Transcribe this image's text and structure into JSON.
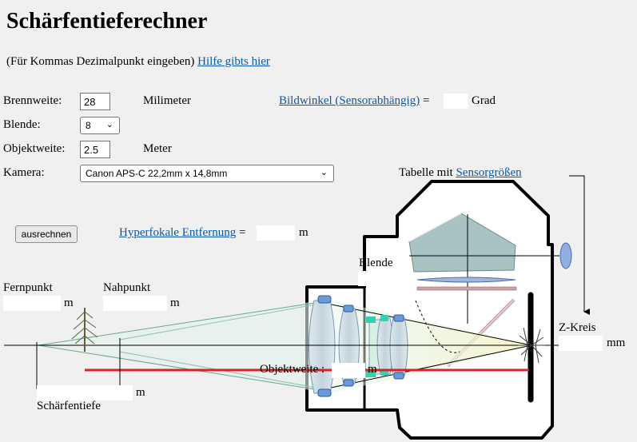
{
  "title": "Schärfentieferechner",
  "intro": {
    "text": "(Für Kommas Dezimalpunkt eingeben)",
    "help_link": "Hilfe gibts hier"
  },
  "form": {
    "focal": {
      "label": "Brennweite:",
      "value": "28",
      "unit": "Milimeter"
    },
    "aperture": {
      "label": "Blende:",
      "selected": "8"
    },
    "distance": {
      "label": "Objektweite:",
      "value": "2.5",
      "unit": "Meter"
    },
    "camera": {
      "label": "Kamera:",
      "selected": "Canon APS-C 22,2mm x 14,8mm"
    }
  },
  "angle": {
    "link": "Bildwinkel (Sensorabhängig)",
    "eq": "=",
    "value": "",
    "unit": "Grad"
  },
  "sensor_table": {
    "prefix": "Tabelle mit",
    "link": "Sensorgrößen"
  },
  "calc_button": "ausrechnen",
  "hyperfocal": {
    "link": "Hyperfokale Entfernung",
    "eq": "=",
    "value": "",
    "unit": "m"
  },
  "diagram": {
    "blende_label": "Blende",
    "blende_value": "",
    "far_label": "Fernpunkt",
    "far_value": "",
    "far_unit": "m",
    "near_label": "Nahpunkt",
    "near_value": "",
    "near_unit": "m",
    "dof_label": "Schärfentiefe",
    "dof_value": "",
    "dof_unit": "m",
    "object_label": "Objektweite :",
    "object_value": "",
    "object_unit": "m",
    "coc_label": "Z-Kreis",
    "coc_value": "",
    "coc_unit": "mm"
  },
  "colors": {
    "link": "#0b57a8",
    "distance_line": "#e02020",
    "lens_blue": "#6b9ad8",
    "prism": "#9db8b8"
  }
}
